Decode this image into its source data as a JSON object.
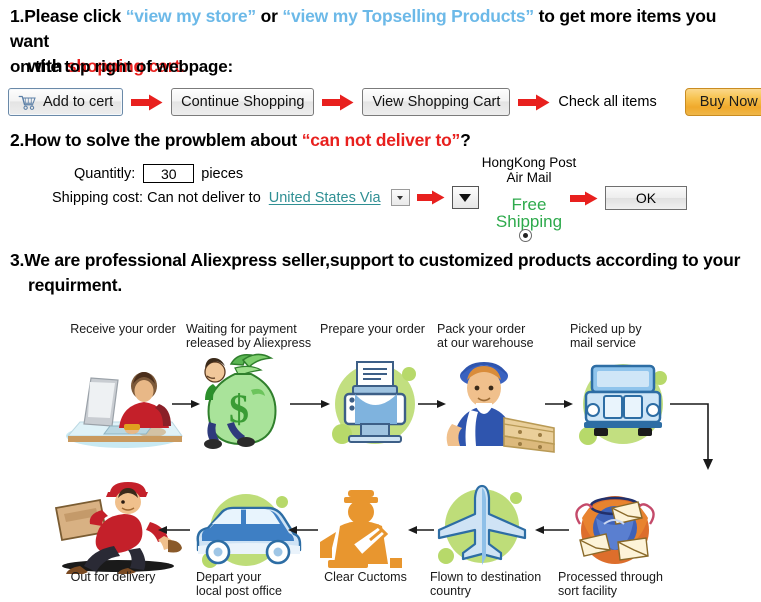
{
  "section1": {
    "number": "1.",
    "line1_a": "Please click ",
    "link1": "“view my store”",
    "line1_b": " or ",
    "link2": "“view my Topselling Products”",
    "line1_c": " to get more items you want",
    "line2_a": "with ",
    "line2_highlight": "shopping cart.",
    "line3": "on the top right of webpage:"
  },
  "buttons": {
    "add_to_cart": "Add to cert",
    "cart_icon": "shopping-cart-icon",
    "continue_shopping": "Continue Shopping",
    "view_shopping_cart": "View Shopping Cart",
    "check_all_items": "Check all items",
    "buy_now": "Buy Now",
    "arrow_icon": "arrow-right-red-icon"
  },
  "section2": {
    "number": "2.",
    "heading_a": "How to solve the prowblem about ",
    "heading_quote": "“can not deliver to”",
    "heading_b": "?",
    "quantity_label": "Quantitly:",
    "quantity_value": "30",
    "pieces_label": "pieces",
    "shipping_label": "Shipping cost: Can not deliver to",
    "shipping_country": "United States Via",
    "dropdown_icon": "chevron-down-icon",
    "carrier_line1": "HongKong Post",
    "carrier_line2": "Air Mail",
    "free_line1": "Free",
    "free_line2": "Shipping",
    "radio_icon": "radio-selected-icon",
    "ok_button": "OK"
  },
  "section3": {
    "number": "3.",
    "line1": "We are professional Aliexpress seller,support to customized products according to your",
    "line2": "requirment."
  },
  "flowchart": {
    "steps": [
      {
        "label1": "Receive your order",
        "label2": "",
        "icon": "person-at-computer-icon"
      },
      {
        "label1": "Waiting for payment",
        "label2": "released by Aliexpress",
        "icon": "money-bag-icon"
      },
      {
        "label1": "Prepare your order",
        "label2": "",
        "icon": "printer-icon"
      },
      {
        "label1": "Pack your order",
        "label2": "at our warehouse",
        "icon": "warehouse-worker-icon"
      },
      {
        "label1": "Picked up by",
        "label2": "mail service",
        "icon": "mail-truck-icon"
      },
      {
        "label1": "Processed through",
        "label2": "sort facility",
        "icon": "mail-sorting-icon"
      },
      {
        "label1": "Flown to destination",
        "label2": "country",
        "icon": "airplane-icon"
      },
      {
        "label1": "Clear Cuctoms",
        "label2": "",
        "icon": "customs-officer-icon"
      },
      {
        "label1": "Depart your",
        "label2": "local post office",
        "icon": "delivery-van-icon"
      },
      {
        "label1": "Out for delivery",
        "label2": "",
        "icon": "running-courier-icon"
      }
    ],
    "arrow_icon": "arrow-black-icon"
  },
  "colors": {
    "link_blue": "#6cb9e8",
    "highlight_red": "#e8201e",
    "free_green": "#2eaa4c",
    "country_teal": "#2f8f93",
    "buy_now_orange": "#f0a92c",
    "arrow_red": "#e8201e"
  }
}
